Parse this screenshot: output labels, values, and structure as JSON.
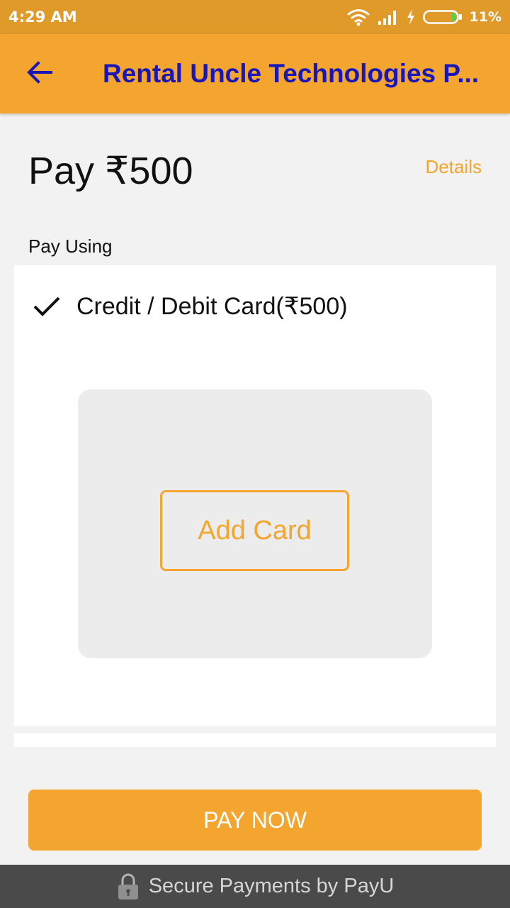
{
  "status_bar": {
    "time": "4:29 AM",
    "battery_percent": "11%",
    "icons": [
      "wifi-icon",
      "signal-icon",
      "charging-icon",
      "battery-icon"
    ],
    "battery_level": 0.11
  },
  "app_bar": {
    "back_icon": "arrow-left-icon",
    "title": "Rental Uncle Technologies P..."
  },
  "payment": {
    "amount_label": "Pay ₹500",
    "details_label": "Details",
    "pay_using_label": "Pay Using"
  },
  "method": {
    "selected_icon": "check-icon",
    "label": "Credit / Debit Card(₹500)",
    "add_card_label": "Add Card"
  },
  "actions": {
    "pay_now_label": "PAY NOW"
  },
  "footer": {
    "lock_icon": "lock-icon",
    "text": "Secure Payments by PayU"
  },
  "colors": {
    "status_bar": "#e09a2a",
    "accent": "#f3a52f",
    "title_text": "#1a17b6",
    "footer_bg": "#4a4a4a",
    "page_bg": "#f2f2f2"
  }
}
